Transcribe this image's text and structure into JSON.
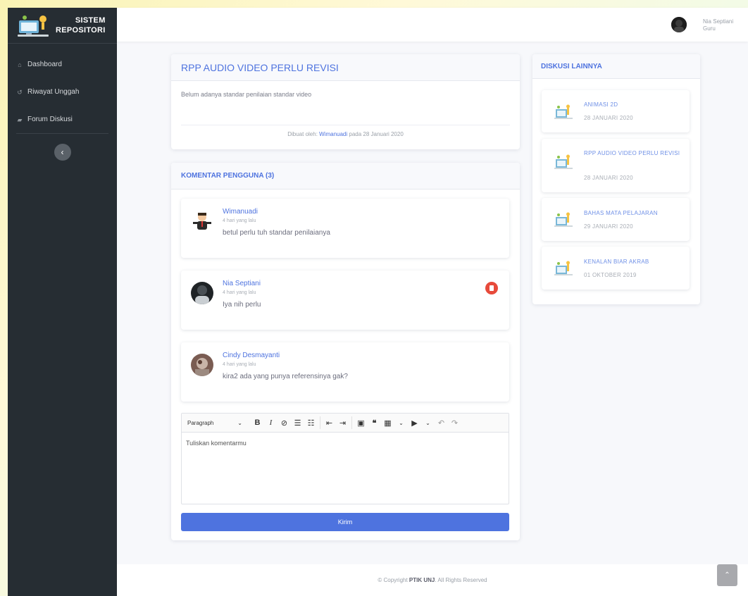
{
  "brand": {
    "line1": "SISTEM",
    "line2": "REPOSITORI"
  },
  "sidebar": {
    "items": [
      {
        "label": "Dashboard",
        "icon": "home-icon"
      },
      {
        "label": "Riwayat Unggah",
        "icon": "history-icon"
      },
      {
        "label": "Forum Diskusi",
        "icon": "chat-icon"
      }
    ],
    "toggle_icon": "‹"
  },
  "user": {
    "name": "Nia Septiani",
    "role": "Guru"
  },
  "post": {
    "title": "RPP AUDIO VIDEO PERLU REVISI",
    "body": "Belum adanya standar penilaian standar video",
    "meta_prefix": "Dibuat oleh: ",
    "author": "Wimanuadi",
    "meta_suffix": " pada 28 Januari 2020"
  },
  "comments": {
    "header": "KOMENTAR PENGGUNA (3)",
    "items": [
      {
        "name": "Wimanuadi",
        "time": "4 hari yang lalu",
        "text": "betul perlu tuh standar penilaianya",
        "deletable": false
      },
      {
        "name": "Nia Septiani",
        "time": "4 hari yang lalu",
        "text": "Iya nih perlu",
        "deletable": true
      },
      {
        "name": "Cindy Desmayanti",
        "time": "4 hari yang lalu",
        "text": "kira2 ada yang punya referensinya gak?",
        "deletable": false
      }
    ]
  },
  "editor": {
    "format_select": "Paragraph",
    "placeholder": "Tuliskan komentarmu",
    "submit_label": "Kirim"
  },
  "discussions": {
    "header": "DISKUSI LAINNYA",
    "items": [
      {
        "title": "ANIMASI 2D",
        "date": "28 JANUARI 2020"
      },
      {
        "title": "RPP AUDIO VIDEO PERLU REVISI",
        "date": "28 JANUARI 2020"
      },
      {
        "title": "BAHAS MATA PELAJARAN",
        "date": "29 JANUARI 2020"
      },
      {
        "title": "KENALAN BIAR AKRAB",
        "date": "01 OKTOBER 2019"
      }
    ]
  },
  "footer": {
    "prefix": "© Copyright ",
    "brand": "PTIK UNJ",
    "suffix": ". All Rights Reserved"
  },
  "colors": {
    "primary": "#4e73df",
    "sidebar": "#262d33",
    "danger": "#e74a3b"
  }
}
